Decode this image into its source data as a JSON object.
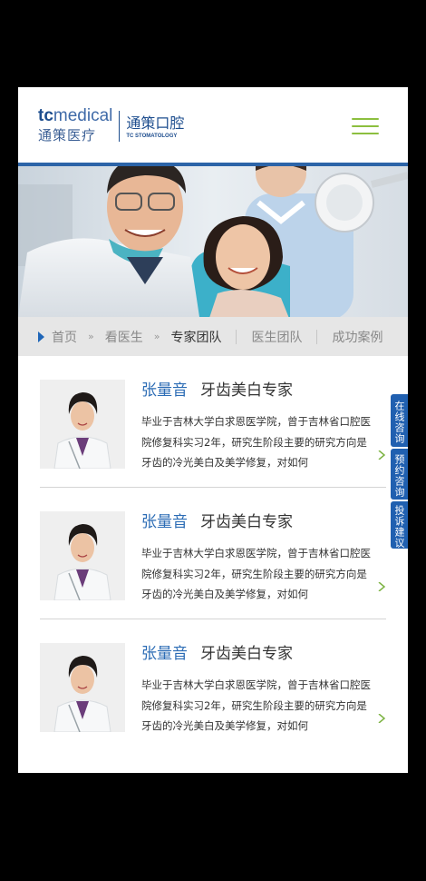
{
  "brand": {
    "logo_mark_prefix": "tc",
    "logo_mark_suffix": "medical",
    "logo_cn": "通策医疗",
    "logo_right_cn": "通策口腔",
    "logo_right_en": "TC STOMATOLOGY",
    "accent": "#2c64a8",
    "menu_color": "#8cbf3f"
  },
  "breadcrumb": {
    "items": [
      "首页",
      "看医生",
      "专家团队",
      "医生团队",
      "成功案例"
    ],
    "separators": [
      "»",
      "»"
    ]
  },
  "doctors": [
    {
      "name": "张量音",
      "title": "牙齿美白专家",
      "description": "毕业于吉林大学白求恩医学院，曾于吉林省口腔医院修复科实习2年，研究生阶段主要的研究方向是牙齿的冷光美白及美学修复，对如何"
    },
    {
      "name": "张量音",
      "title": "牙齿美白专家",
      "description": "毕业于吉林大学白求恩医学院，曾于吉林省口腔医院修复科实习2年，研究生阶段主要的研究方向是牙齿的冷光美白及美学修复，对如何"
    },
    {
      "name": "张量音",
      "title": "牙齿美白专家",
      "description": "毕业于吉林大学白求恩医学院，曾于吉林省口腔医院修复科实习2年，研究生阶段主要的研究方向是牙齿的冷光美白及美学修复，对如何"
    }
  ],
  "side_tabs": [
    "在线咨询",
    "预约咨询",
    "投诉建议"
  ]
}
